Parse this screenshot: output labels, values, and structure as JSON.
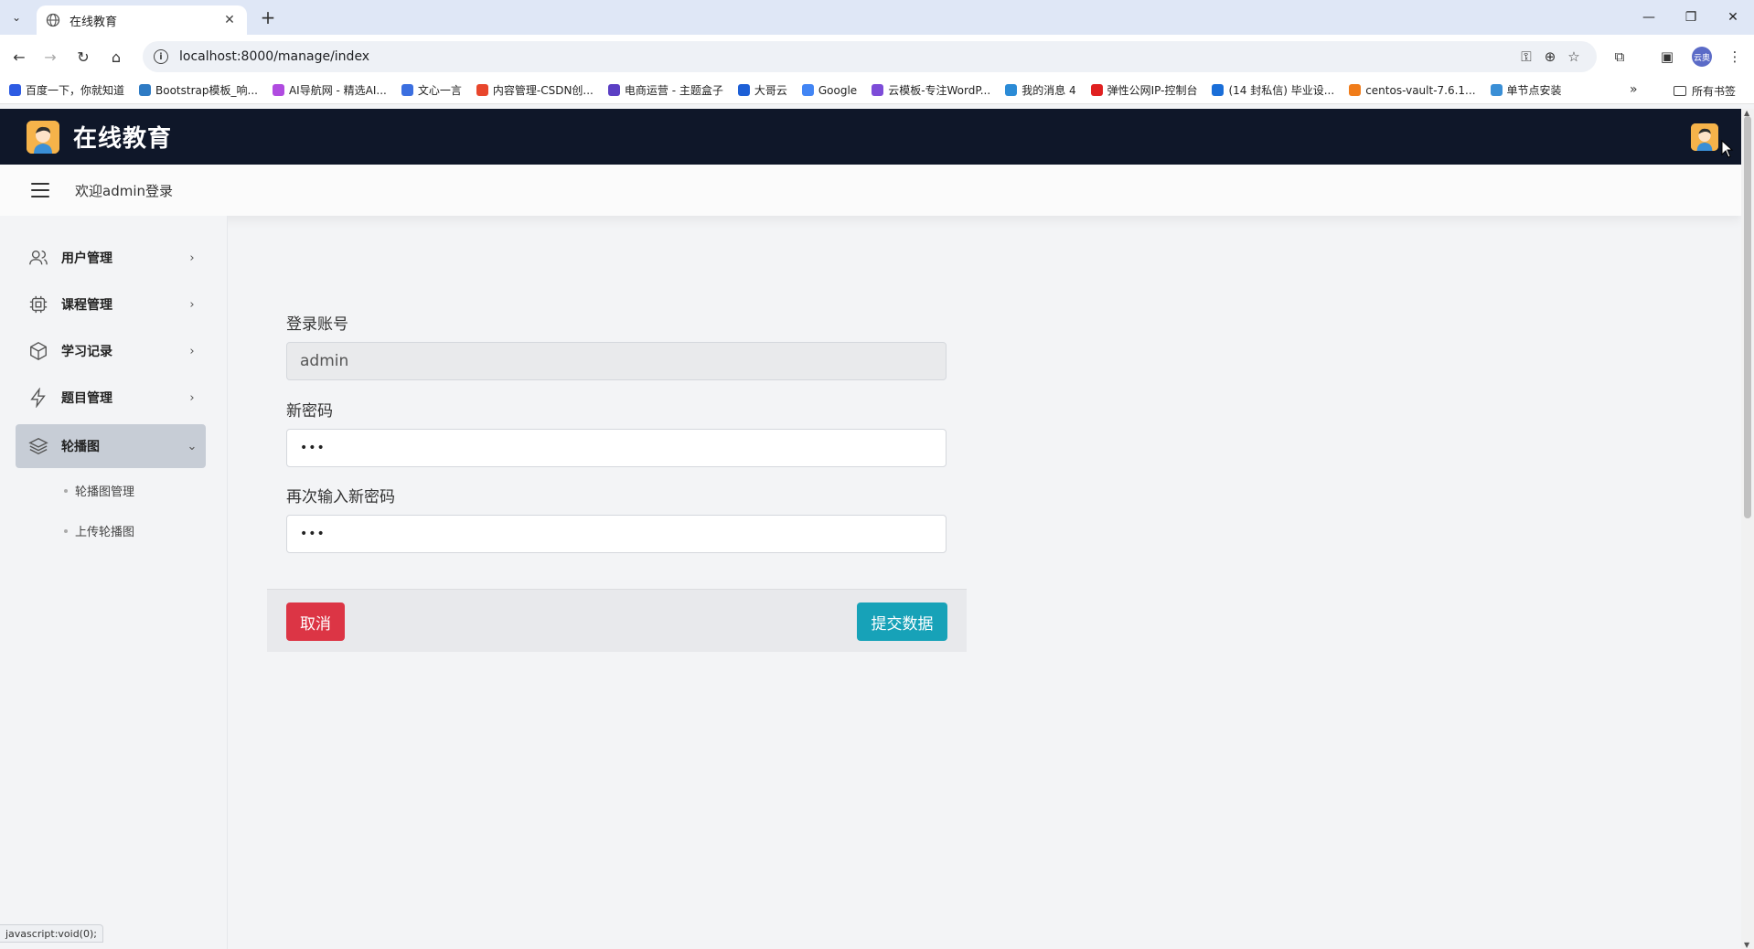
{
  "browser": {
    "tab_title": "在线教育",
    "url": "localhost:8000/manage/index",
    "bookmarks": [
      {
        "label": "百度一下，你就知道",
        "color": "#2d5be3"
      },
      {
        "label": "Bootstrap模板_响...",
        "color": "#2e7bc4"
      },
      {
        "label": "AI导航网 - 精选AI...",
        "color": "#b04be0"
      },
      {
        "label": "文心一言",
        "color": "#3b6fe0"
      },
      {
        "label": "内容管理-CSDN创...",
        "color": "#e8462c"
      },
      {
        "label": "电商运营 - 主题盒子",
        "color": "#5b3fc4"
      },
      {
        "label": "大哥云",
        "color": "#1d5fd6"
      },
      {
        "label": "Google",
        "color": "#4285f4"
      },
      {
        "label": "云模板-专注WordP...",
        "color": "#7d4cd8"
      },
      {
        "label": "我的消息 4",
        "color": "#2b8bd6"
      },
      {
        "label": "弹性公网IP-控制台",
        "color": "#e02020"
      },
      {
        "label": "(14 封私信) 毕业设...",
        "color": "#1a6ed8"
      },
      {
        "label": "centos-vault-7.6.1...",
        "color": "#f07c1a"
      },
      {
        "label": "单节点安装",
        "color": "#3a8fd6"
      }
    ],
    "all_bookmarks": "所有书签",
    "profile_label": "云奥"
  },
  "app": {
    "title": "在线教育",
    "welcome": "欢迎admin登录"
  },
  "sidebar": {
    "items": [
      {
        "label": "用户管理"
      },
      {
        "label": "课程管理"
      },
      {
        "label": "学习记录"
      },
      {
        "label": "题目管理"
      },
      {
        "label": "轮播图"
      }
    ],
    "submenu": [
      {
        "label": "轮播图管理"
      },
      {
        "label": "上传轮播图"
      }
    ]
  },
  "form": {
    "account_label": "登录账号",
    "account_value": "admin",
    "new_password_label": "新密码",
    "new_password_value": "•••",
    "confirm_password_label": "再次输入新密码",
    "confirm_password_value": "•••",
    "cancel_label": "取消",
    "submit_label": "提交数据"
  },
  "status_bar": "javascript:void(0);",
  "colors": {
    "header_bg": "#0f1729",
    "cancel": "#dc3545",
    "submit": "#17a2b8"
  }
}
